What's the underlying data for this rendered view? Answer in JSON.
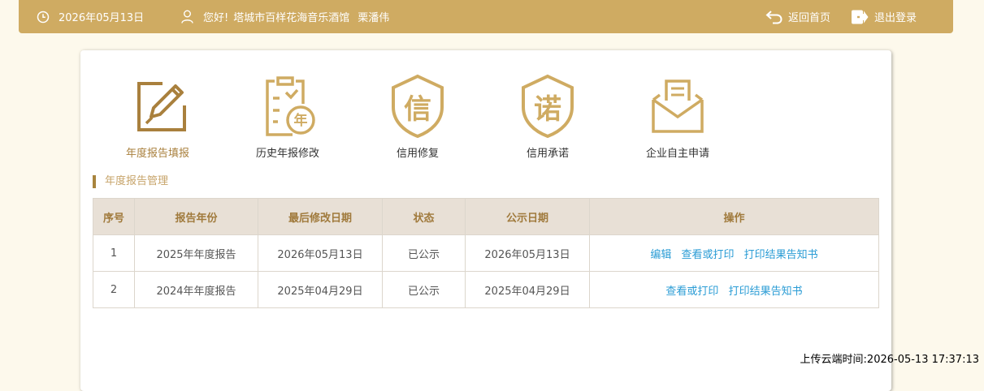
{
  "header": {
    "date": "2026年05月13日",
    "greeting": "您好!",
    "org_name": "塔城市百样花海音乐酒馆",
    "user_name": "栗潘伟",
    "home_link": "返回首页",
    "logout_link": "退出登录"
  },
  "menu": {
    "items": [
      {
        "label": "年度报告填报",
        "icon": "report-edit-icon",
        "active": true
      },
      {
        "label": "历史年报修改",
        "icon": "history-report-icon",
        "badge": "年"
      },
      {
        "label": "信用修复",
        "icon": "credit-repair-shield-icon",
        "badge": "信"
      },
      {
        "label": "信用承诺",
        "icon": "credit-promise-shield-icon",
        "badge": "诺"
      },
      {
        "label": "企业自主申请",
        "icon": "envelope-icon"
      }
    ]
  },
  "section": {
    "title": "年度报告管理"
  },
  "table": {
    "headers": [
      "序号",
      "报告年份",
      "最后修改日期",
      "状态",
      "公示日期",
      "操作"
    ],
    "rows": [
      {
        "index": "1",
        "year": "2025年年度报告",
        "modified": "2026年05月13日",
        "status": "已公示",
        "publish_date": "2026年05月13日",
        "actions": [
          "编辑",
          "查看或打印",
          "打印结果告知书"
        ]
      },
      {
        "index": "2",
        "year": "2024年年度报告",
        "modified": "2025年04月29日",
        "status": "已公示",
        "publish_date": "2025年04月29日",
        "actions": [
          "查看或打印",
          "打印结果告知书"
        ]
      }
    ]
  },
  "footer": {
    "upload_time": "上传云端时间:2026-05-13 17:37:13"
  },
  "colors": {
    "gold": "#cfab62",
    "dark_gold": "#a9803d",
    "link_blue": "#2a9cd5",
    "page_bg": "#fdf9ec"
  }
}
